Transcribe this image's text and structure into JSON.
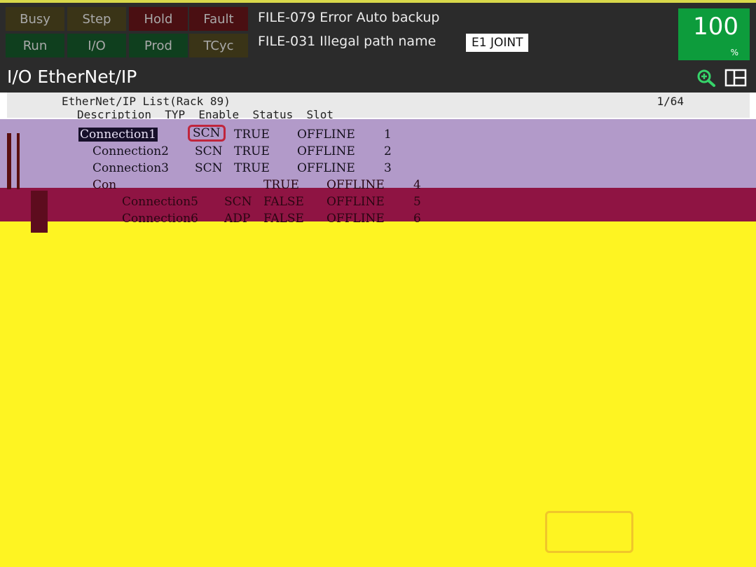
{
  "status": {
    "lamps": [
      {
        "label": "Busy"
      },
      {
        "label": "Step"
      },
      {
        "label": "Hold"
      },
      {
        "label": "Fault"
      },
      {
        "label": "Run"
      },
      {
        "label": "I/O"
      },
      {
        "label": "Prod"
      },
      {
        "label": "TCyc"
      }
    ],
    "alarm_line_1": "FILE-079 Error Auto backup",
    "alarm_line_2": "FILE-031 Illegal path name",
    "mode": "E1 JOINT",
    "override_value": "100",
    "override_unit": "%"
  },
  "screen": {
    "title": "I/O EtherNet/IP",
    "zoom_icon": "zoom-in-icon",
    "split_icon": "split-screen-icon"
  },
  "list": {
    "title": "EtherNet/IP List(Rack 89)",
    "page": "1/64",
    "columns": "Description  TYP  Enable  Status  Slot",
    "rows": [
      {
        "description": "Connection1",
        "typ": "SCN",
        "enable": "TRUE",
        "status": "OFFLINE",
        "slot": "1"
      },
      {
        "description": "Connection2",
        "typ": "SCN",
        "enable": "TRUE",
        "status": "OFFLINE",
        "slot": "2"
      },
      {
        "description": "Connection3",
        "typ": "SCN",
        "enable": "TRUE",
        "status": "OFFLINE",
        "slot": "3"
      },
      {
        "description": "Con",
        "typ": "",
        "enable": "TRUE",
        "status": "OFFLINE",
        "slot": "4"
      },
      {
        "description": "Connection5",
        "typ": "SCN",
        "enable": "FALSE",
        "status": "OFFLINE",
        "slot": "5"
      },
      {
        "description": "Connection6",
        "typ": "ADP",
        "enable": "FALSE",
        "status": "OFFLINE",
        "slot": "6"
      }
    ]
  },
  "colors": {
    "status_bar": "#2b2b2b",
    "override_green": "#0d9c3c",
    "band_purple": "#b29ac9",
    "band_crimson": "#8f1443",
    "band_yellow": "#fef422",
    "focus_red": "#c0253c"
  }
}
